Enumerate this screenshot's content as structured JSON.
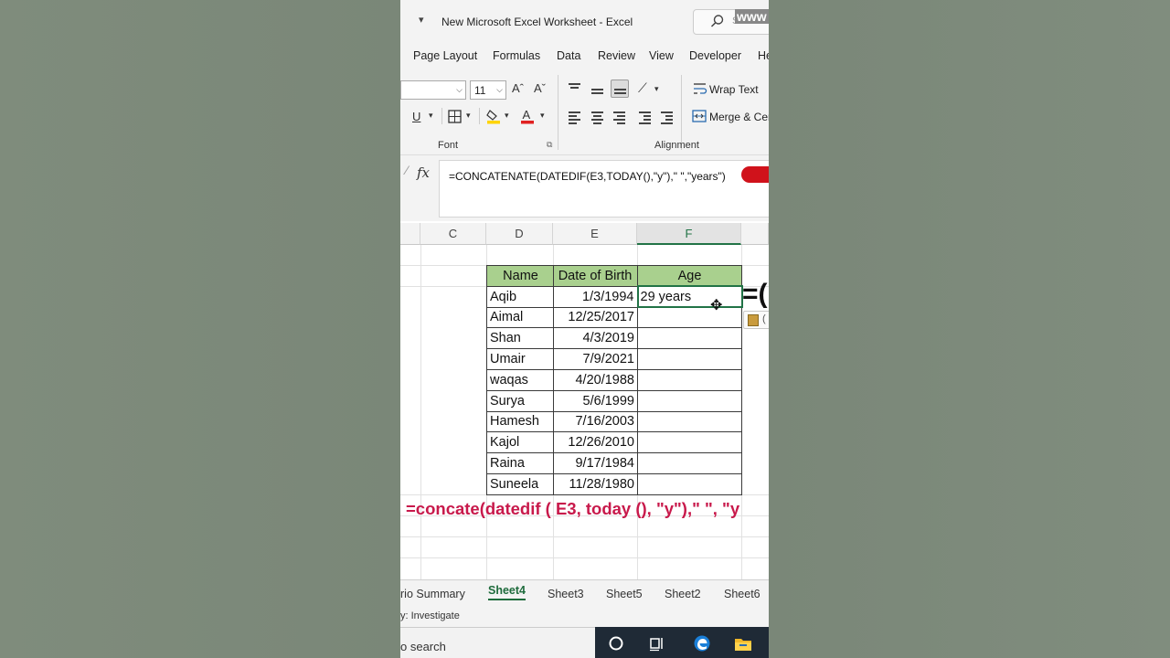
{
  "window": {
    "title": "New Microsoft Excel Worksheet  -  Excel",
    "qat_arrow": "▾",
    "search_placeholder": "Search",
    "watermark": "www"
  },
  "ribbon_tabs": [
    "Page Layout",
    "Formulas",
    "Data",
    "Review",
    "View",
    "Developer",
    "He"
  ],
  "font_group": {
    "font_size": "11",
    "grow_label": "Aˆ",
    "shrink_label": "Aˇ",
    "underline_label": "U",
    "label": "Font"
  },
  "alignment_group": {
    "wrap_text_label": "Wrap Text",
    "merge_label": "Merge & Cen",
    "label": "Alignment"
  },
  "formula_bar": {
    "fx_label": "fx",
    "formula": "=CONCATENATE(DATEDIF(E3,TODAY(),\"y\"),\" \",\"years\")"
  },
  "columns": [
    "C",
    "D",
    "E",
    "F"
  ],
  "table": {
    "headers": [
      "Name",
      "Date of Birth",
      "Age"
    ],
    "rows": [
      [
        "Aqib",
        "1/3/1994",
        "29 years"
      ],
      [
        "Aimal",
        "12/25/2017",
        ""
      ],
      [
        "Shan",
        "4/3/2019",
        ""
      ],
      [
        "Umair",
        "7/9/2021",
        ""
      ],
      [
        "waqas",
        "4/20/1988",
        ""
      ],
      [
        "Surya",
        "5/6/1999",
        ""
      ],
      [
        "Hamesh",
        "7/16/2003",
        ""
      ],
      [
        "Kajol",
        "12/26/2010",
        ""
      ],
      [
        "Raina",
        "9/17/1984",
        ""
      ],
      [
        "Suneela",
        "11/28/1980",
        ""
      ]
    ]
  },
  "overlay": {
    "big_equals": "=(",
    "paste_label": "(",
    "caption": "=concate(datedif ( E3, today (), \"y\"),\" \", \"y"
  },
  "sheet_tabs": [
    "rio Summary",
    "Sheet4",
    "Sheet3",
    "Sheet5",
    "Sheet2",
    "Sheet6"
  ],
  "active_sheet": "Sheet4",
  "status": {
    "text": "y: Investigate"
  },
  "taskbar": {
    "search_text": "o search"
  },
  "colors": {
    "header_fill": "#a9d08e",
    "excel_green": "#217346",
    "caption_color": "#c8194b",
    "red_pill": "#d0121b"
  }
}
